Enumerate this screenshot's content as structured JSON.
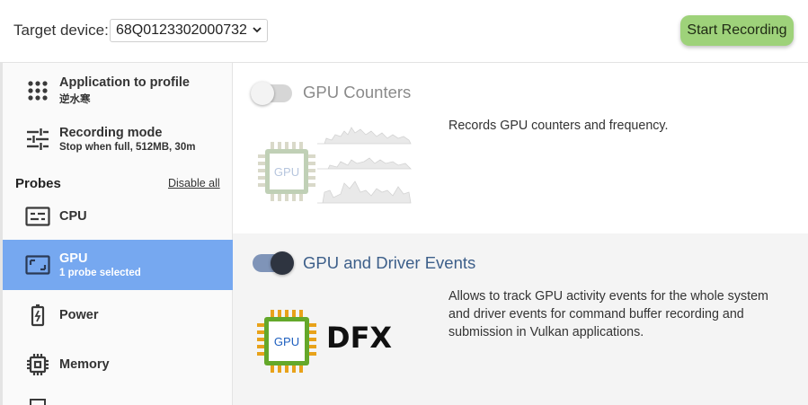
{
  "header": {
    "target_label": "Target device:",
    "device_value": "68Q0123302000732",
    "start_button": "Start Recording"
  },
  "sidebar": {
    "app": {
      "title": "Application to profile",
      "subtitle": "逆水寒",
      "icon": "apps-grid-icon"
    },
    "mode": {
      "title": "Recording mode",
      "subtitle": "Stop when full, 512MB, 30m",
      "icon": "sliders-icon"
    },
    "probes_heading": "Probes",
    "disable_all": "Disable all",
    "items": [
      {
        "label": "CPU",
        "icon": "cpu-icon"
      },
      {
        "label": "GPU",
        "sublabel": "1 probe selected",
        "icon": "gpu-icon",
        "selected": true
      },
      {
        "label": "Power",
        "icon": "battery-icon"
      },
      {
        "label": "Memory",
        "icon": "memory-chip-icon"
      }
    ]
  },
  "main": {
    "gpu_counters": {
      "title": "GPU Counters",
      "enabled": false,
      "description": "Records GPU counters and frequency.",
      "chip_label": "GPU"
    },
    "gpu_driver_events": {
      "title": "GPU and Driver Events",
      "enabled": true,
      "description_lines": [
        "Allows to track GPU activity events for the whole system",
        "and driver events for command buffer recording and",
        "submission in Vulkan applications."
      ],
      "chip_label": "GPU",
      "logo_text": "DFX"
    }
  },
  "colors": {
    "accent_selected": "#76a8f0",
    "start_button": "#9ed27a",
    "toggle_on_track": "#7f94b8",
    "toggle_on_knob": "#2e3440",
    "enabled_title": "#3d5f8a",
    "disabled_title": "#8a8a8a",
    "chip_green": "#64a82a",
    "chip_orange": "#e8a21a"
  }
}
